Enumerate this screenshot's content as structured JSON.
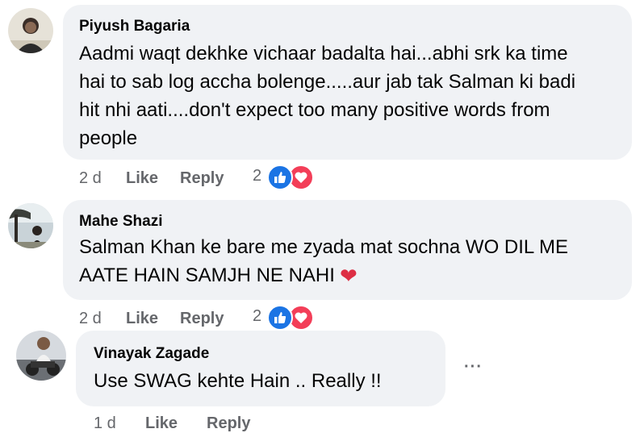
{
  "comments": [
    {
      "author": "Piyush Bagaria",
      "lines": [
        "Aadmi waqt dekhke vichaar badalta hai...abhi srk ka time",
        "hai to sab log accha bolenge.....aur jab tak Salman ki badi",
        "hit nhi aati....don't expect too many positive words from",
        "people"
      ],
      "time": "2 d",
      "like": "Like",
      "reply": "Reply",
      "reaction_count": "2"
    },
    {
      "author": "Mahe Shazi",
      "lines": [
        "Salman Khan ke bare me zyada mat sochna WO DIL ME",
        "AATE HAIN SAMJH NE NAHI"
      ],
      "time": "2 d",
      "like": "Like",
      "reply": "Reply",
      "reaction_count": "2"
    },
    {
      "author": "Vinayak Zagade",
      "lines": [
        "Use SWAG kehte Hain .. Really !!"
      ],
      "time": "1 d",
      "like": "Like",
      "reply": "Reply",
      "more": "···"
    }
  ],
  "icons": {
    "like_icon": "thumbs-up-icon",
    "love_icon": "heart-icon",
    "heart_emoji": "heart-emoji-icon",
    "more_icon": "more-options-icon"
  },
  "colors": {
    "bubble": "#f0f2f5",
    "text": "#050505",
    "meta": "#65676b",
    "like": "#1b74e4",
    "love": "#f33e58"
  }
}
